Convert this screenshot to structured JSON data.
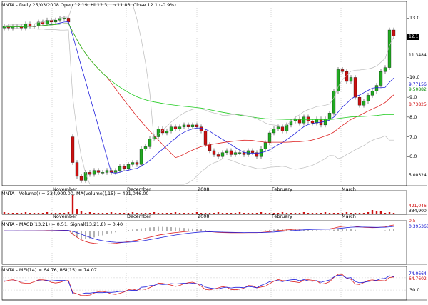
{
  "header": {
    "title": "MNTA - Daily 25/03/2008 Open 12.19, Hi 12.3, Lo 11.83, Close 12.1 (-0.9%)"
  },
  "price_panel": {
    "axis_ticks": [
      "13.0",
      "12.0",
      "11.0",
      "10.0",
      "9.0",
      "8.0",
      "7.0",
      "6.0",
      "5.0"
    ],
    "tags": [
      {
        "text": "12.1",
        "bg": "#000000",
        "fg": "#ffffff"
      },
      {
        "text": "11.3484",
        "bg": "#ffffff",
        "fg": "#000000"
      },
      {
        "text": "9.77156",
        "bg": "#ffffff",
        "fg": "#0000cc"
      },
      {
        "text": "9.50882",
        "bg": "#ffffff",
        "fg": "#008800"
      },
      {
        "text": "8.73825",
        "bg": "#ffffff",
        "fg": "#cc0000"
      },
      {
        "text": "5.00324",
        "bg": "#ffffff",
        "fg": "#000000"
      }
    ]
  },
  "month_labels": [
    "November",
    "December",
    "2008",
    "February",
    "March"
  ],
  "volume_panel": {
    "legend": "MNTA - Volume() = 334,900.00, MA(Volume(),15) = 421,046.00",
    "tags": [
      {
        "text": "421,046",
        "bg": "#ffffff",
        "fg": "#cc0000"
      },
      {
        "text": "334,900",
        "bg": "#ffffff",
        "fg": "#000000"
      }
    ]
  },
  "macd_panel": {
    "legend": "MNTA - MACD(13,21) = 0.51, Signal(13,21,8) = 0.40",
    "tags": [
      {
        "text": "0.5",
        "bg": "#ffffff",
        "fg": "#cc0000"
      },
      {
        "text": "0.395368",
        "bg": "#ffffff",
        "fg": "#0000cc"
      }
    ]
  },
  "mfi_panel": {
    "legend": "MNTA - MFI(14) = 64.76, RSI(15) = 74.07",
    "axis_ticks": [
      "70.0",
      "30.0"
    ],
    "tags": [
      {
        "text": "74.0664",
        "bg": "#ffffff",
        "fg": "#0000cc"
      },
      {
        "text": "64.7602",
        "bg": "#ffffff",
        "fg": "#cc0000"
      }
    ]
  },
  "colors": {
    "up_candle": "#22aa22",
    "down_candle": "#cc1111",
    "ma_blue": "#2222dd",
    "ma_red": "#dd2222",
    "ma_green": "#22cc22",
    "bollinger": "#bbbbbb",
    "background": "#ffffff"
  },
  "chart_data": {
    "type": "candlestick",
    "title": "MNTA - Daily 25/03/2008 Open 12.19, Hi 12.3, Lo 11.83, Close 12.1 (-0.9%)",
    "closes": [
      12.6,
      12.5,
      12.6,
      12.6,
      12.5,
      12.7,
      12.6,
      12.6,
      12.8,
      12.7,
      12.9,
      12.8,
      12.9,
      13.0,
      13.0,
      12.8,
      5.7,
      5.0,
      4.8,
      5.2,
      5.1,
      5.3,
      5.2,
      5.2,
      5.3,
      5.2,
      5.3,
      5.5,
      5.4,
      5.6,
      5.7,
      5.6,
      6.4,
      6.5,
      6.9,
      7.0,
      7.4,
      7.2,
      7.3,
      7.5,
      7.4,
      7.5,
      7.6,
      7.5,
      7.6,
      7.5,
      7.3,
      6.6,
      6.3,
      6.1,
      6.0,
      6.2,
      6.3,
      6.1,
      6.2,
      6.2,
      6.1,
      6.3,
      6.2,
      6.0,
      6.4,
      6.7,
      7.2,
      7.4,
      7.5,
      7.3,
      7.6,
      7.8,
      7.9,
      7.7,
      8.0,
      7.8,
      7.7,
      7.9,
      7.6,
      7.9,
      8.2,
      9.3,
      10.4,
      10.3,
      9.8,
      10.0,
      9.0,
      8.6,
      8.8,
      9.1,
      9.3,
      9.6,
      10.3,
      10.5,
      12.4,
      12.1
    ],
    "ylim": [
      4.6,
      13.7
    ],
    "volume_ma_last": 421046,
    "volume_last": 334900,
    "macd_last": 0.51,
    "signal_last": 0.4,
    "mfi_last": 64.76,
    "rsi_last": 74.07
  }
}
